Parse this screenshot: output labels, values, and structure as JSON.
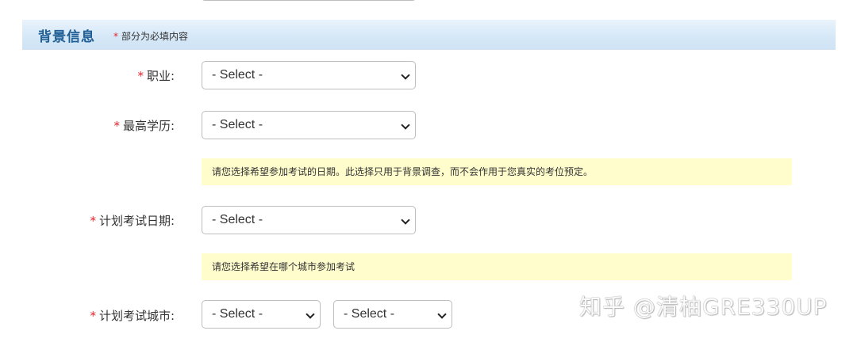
{
  "section": {
    "title": "背景信息",
    "required_star": "*",
    "required_note": "部分为必填内容"
  },
  "fields": {
    "occupation": {
      "star": "*",
      "label": "职业:",
      "value": "- Select -"
    },
    "education": {
      "star": "*",
      "label": "最高学历:",
      "value": "- Select -"
    },
    "exam_date": {
      "star": "*",
      "label": "计划考试日期:",
      "value": "- Select -"
    },
    "exam_city": {
      "star": "*",
      "label": "计划考试城市:",
      "value1": "- Select -",
      "value2": "- Select -"
    }
  },
  "hints": {
    "date_hint": "请您选择希望参加考试的日期。此选择只用于背景调查，而不会作用于您真实的考位预定。",
    "city_hint": "请您选择希望在哪个城市参加考试"
  },
  "watermark": "知乎 @清柚GRE330UP",
  "colors": {
    "section_title": "#1f5e94",
    "required_star": "#e4242b",
    "hint_background": "#fffdcc",
    "section_background": "#d6e8f7"
  }
}
